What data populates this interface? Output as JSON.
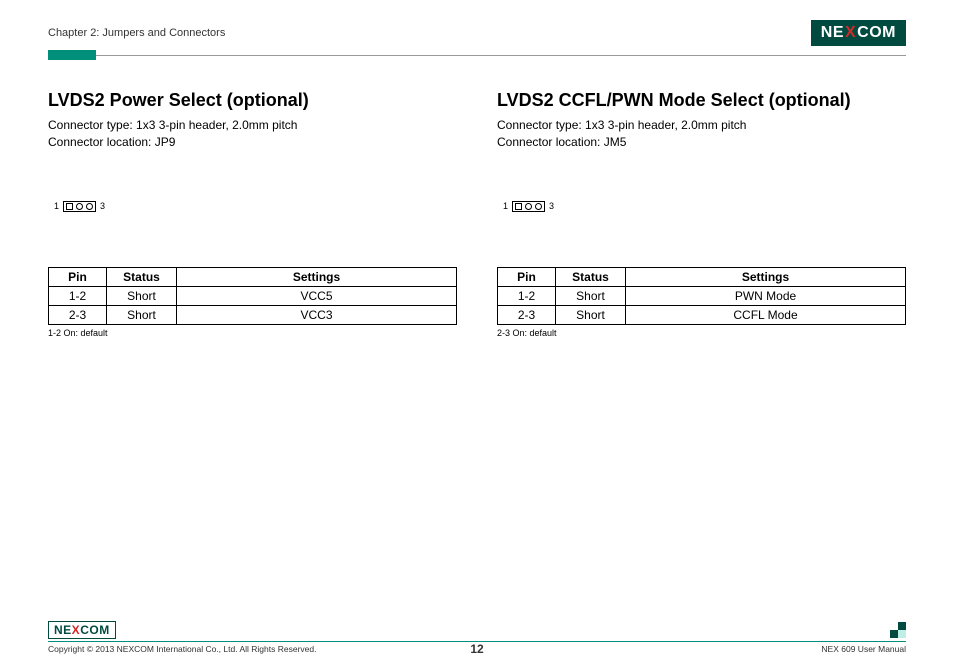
{
  "header": {
    "chapter": "Chapter 2: Jumpers and Connectors",
    "logo_pre": "NE",
    "logo_x": "X",
    "logo_post": "COM"
  },
  "left": {
    "title": "LVDS2 Power Select (optional)",
    "conn_type": "Connector type: 1x3 3-pin header, 2.0mm pitch",
    "conn_loc": "Connector location: JP9",
    "pin_left": "1",
    "pin_right": "3",
    "table": {
      "h_pin": "Pin",
      "h_status": "Status",
      "h_settings": "Settings",
      "rows": [
        {
          "pin": "1-2",
          "status": "Short",
          "settings": "VCC5"
        },
        {
          "pin": "2-3",
          "status": "Short",
          "settings": "VCC3"
        }
      ]
    },
    "default_note": "1-2 On: default"
  },
  "right": {
    "title": "LVDS2 CCFL/PWN Mode Select (optional)",
    "conn_type": "Connector type: 1x3 3-pin header, 2.0mm pitch",
    "conn_loc": "Connector location: JM5",
    "pin_left": "1",
    "pin_right": "3",
    "table": {
      "h_pin": "Pin",
      "h_status": "Status",
      "h_settings": "Settings",
      "rows": [
        {
          "pin": "1-2",
          "status": "Short",
          "settings": "PWN Mode"
        },
        {
          "pin": "2-3",
          "status": "Short",
          "settings": "CCFL Mode"
        }
      ]
    },
    "default_note": "2-3 On: default"
  },
  "footer": {
    "copyright": "Copyright © 2013 NEXCOM International Co., Ltd. All Rights Reserved.",
    "page_num": "12",
    "manual": "NEX 609 User Manual"
  }
}
